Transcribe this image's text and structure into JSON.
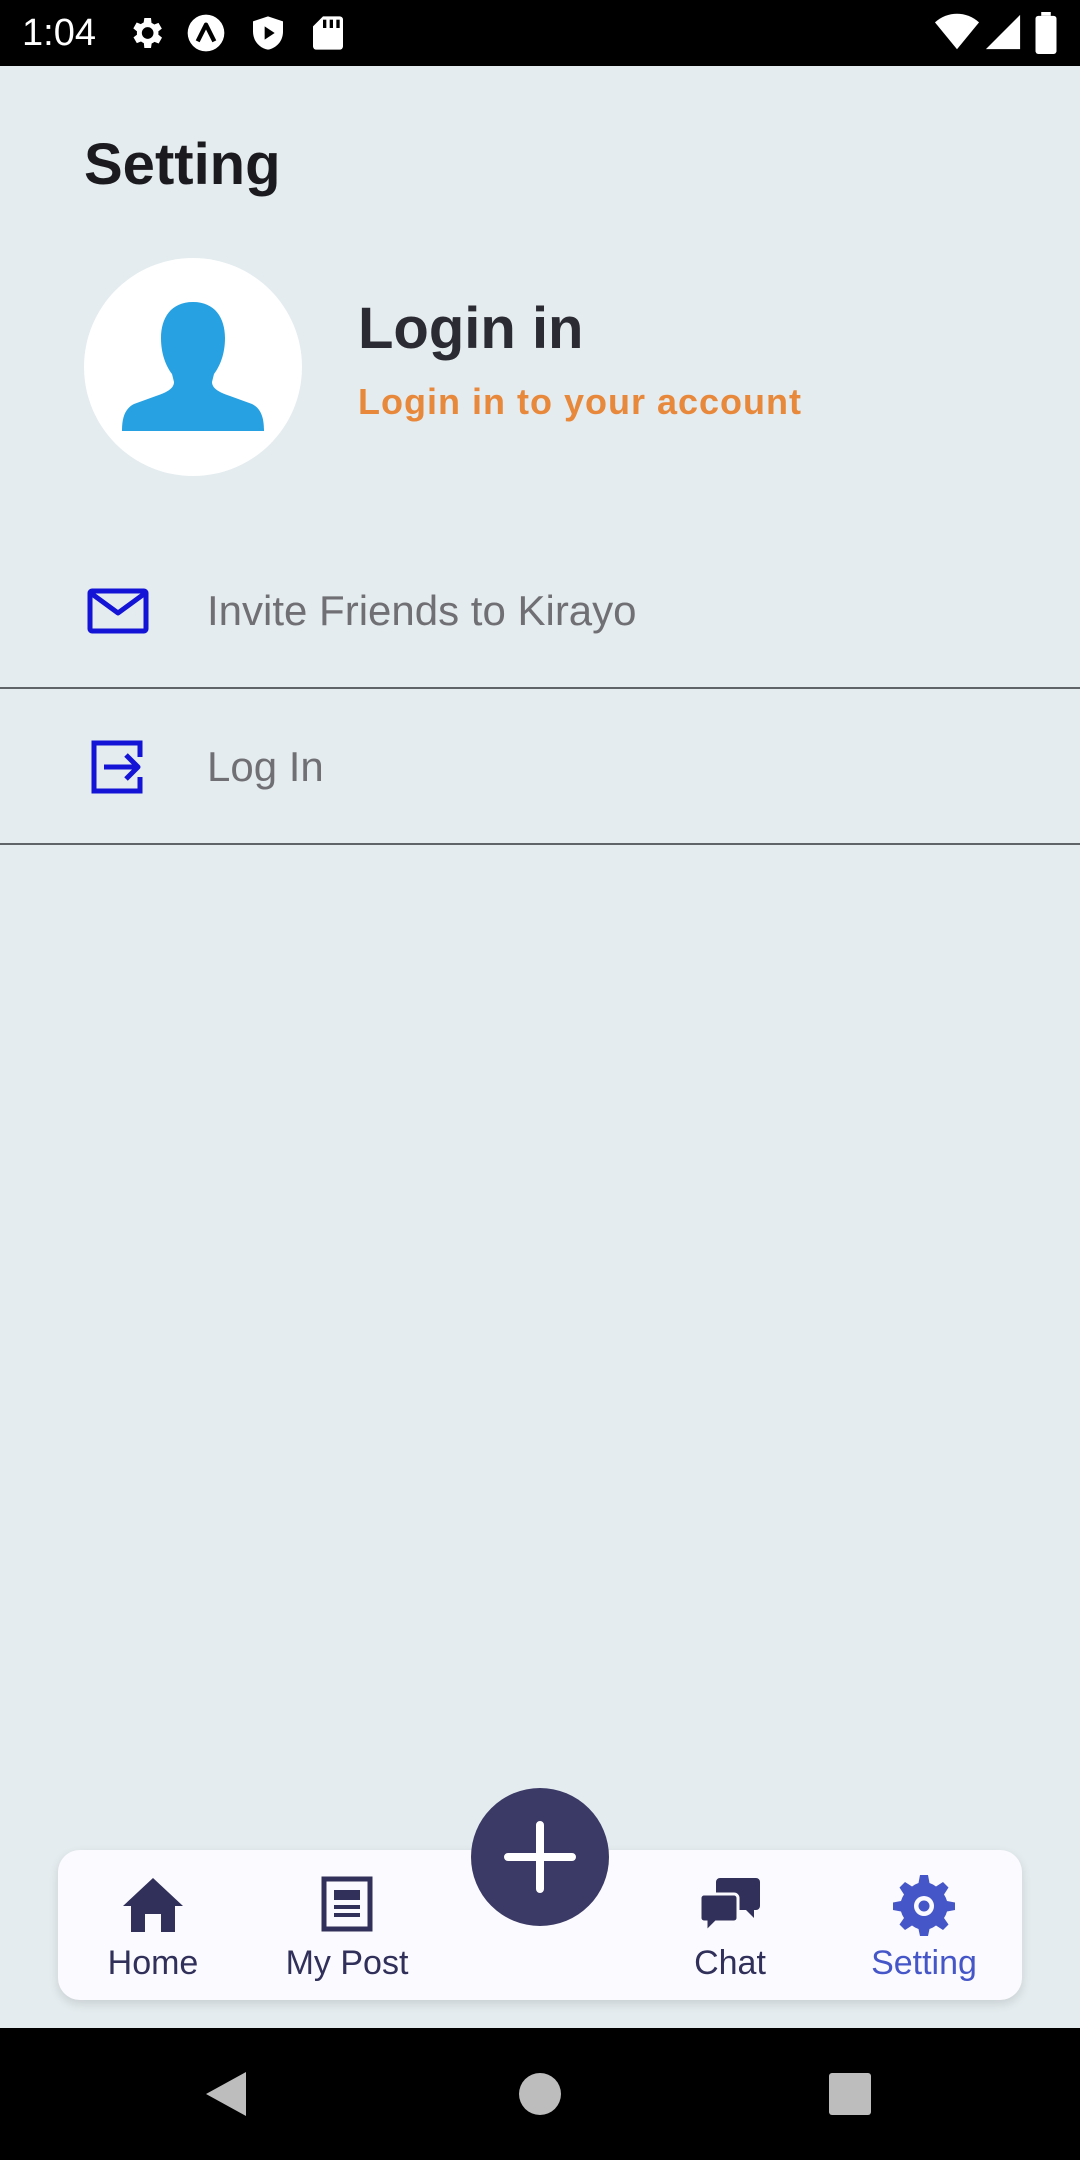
{
  "status_bar": {
    "time": "1:04",
    "icons": [
      "gear-icon",
      "a-logo-icon",
      "shield-play-icon",
      "sd-card-icon",
      "wifi-icon",
      "signal-icon",
      "battery-icon"
    ]
  },
  "page": {
    "title": "Setting"
  },
  "profile": {
    "title": "Login in",
    "subtitle": "Login in to your account",
    "subtitle_color": "#e8883a",
    "avatar_color": "#27a1e2"
  },
  "menu": [
    {
      "label": "Invite Friends to Kirayo",
      "icon": "mail-icon"
    },
    {
      "label": "Log In",
      "icon": "login-icon"
    }
  ],
  "menu_icon_color": "#1414d6",
  "bottom_nav": {
    "items": [
      {
        "label": "Home",
        "icon": "home-icon"
      },
      {
        "label": "My Post",
        "icon": "post-icon"
      },
      {
        "label": "Chat",
        "icon": "chat-icon"
      },
      {
        "label": "Setting",
        "icon": "settings-icon",
        "active": true
      }
    ],
    "fab_icon": "plus-icon",
    "active_color": "#4556c8",
    "icon_color": "#30305a"
  }
}
